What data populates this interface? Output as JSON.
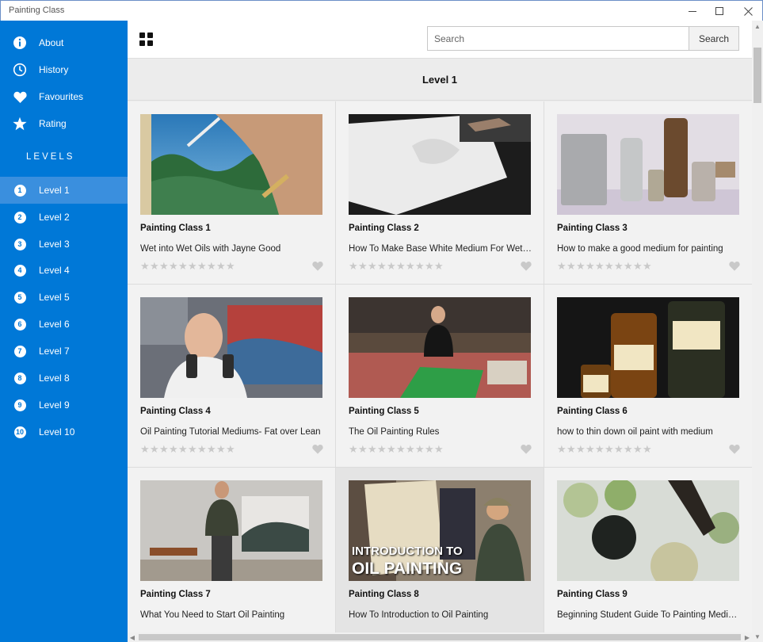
{
  "window": {
    "title": "Painting Class"
  },
  "sidebar": {
    "menu": [
      {
        "label": "About",
        "icon": "info-icon"
      },
      {
        "label": "History",
        "icon": "clock-icon"
      },
      {
        "label": "Favourites",
        "icon": "heart-icon"
      },
      {
        "label": "Rating",
        "icon": "star-icon"
      }
    ],
    "levels_heading": "LEVELS",
    "levels": [
      {
        "num": "1",
        "label": "Level 1"
      },
      {
        "num": "2",
        "label": "Level 2"
      },
      {
        "num": "3",
        "label": "Level 3"
      },
      {
        "num": "4",
        "label": "Level 4"
      },
      {
        "num": "5",
        "label": "Level 5"
      },
      {
        "num": "6",
        "label": "Level 6"
      },
      {
        "num": "7",
        "label": "Level 7"
      },
      {
        "num": "8",
        "label": "Level 8"
      },
      {
        "num": "9",
        "label": "Level 9"
      },
      {
        "num": "10",
        "label": "Level 10"
      }
    ],
    "selected_level": "Level 1"
  },
  "search": {
    "placeholder": "Search",
    "button_label": "Search"
  },
  "main": {
    "level_title": "Level 1",
    "rating_max": 10,
    "cards": [
      {
        "title": "Painting Class 1",
        "desc": "Wet into Wet Oils with Jayne Good"
      },
      {
        "title": "Painting Class 2",
        "desc": "How To Make Base White Medium For Wet on Wet Painting"
      },
      {
        "title": "Painting Class 3",
        "desc": "How to make a good medium for painting"
      },
      {
        "title": "Painting Class 4",
        "desc": "Oil Painting Tutorial Mediums- Fat over Lean"
      },
      {
        "title": "Painting Class 5",
        "desc": "The Oil Painting Rules"
      },
      {
        "title": "Painting Class 6",
        "desc": "how to thin down oil paint with medium"
      },
      {
        "title": "Painting Class 7",
        "desc": "What You Need to Start Oil Painting"
      },
      {
        "title": "Painting Class 8",
        "desc": "How To Introduction to Oil Painting",
        "thumb_text_1": "INTRODUCTION TO",
        "thumb_text_2": "OIL PAINTING"
      },
      {
        "title": "Painting Class 9",
        "desc": "Beginning Student Guide To Painting Mediums"
      }
    ]
  },
  "colors": {
    "accent": "#0078d7",
    "selected": "#3a8fde",
    "star_empty": "#c9c9c9"
  }
}
